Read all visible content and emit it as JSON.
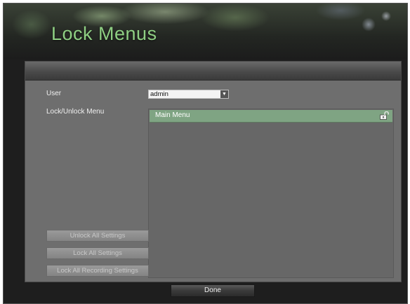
{
  "window": {
    "title": "Lock Menus"
  },
  "form": {
    "user_label": "User",
    "user_value": "admin",
    "lock_menu_label": "Lock/Unlock Menu"
  },
  "menu_list": {
    "items": [
      {
        "label": "Main Menu",
        "icon": "unlocked-padlock-icon",
        "locked": false
      }
    ]
  },
  "actions": {
    "unlock_all": "Unlock All Settings",
    "lock_all": "Lock All Settings",
    "lock_all_recording": "Lock All Recording Settings",
    "done": "Done"
  },
  "colors": {
    "title_green": "#8fcf83",
    "selected_row": "#7fa483",
    "panel": "#6e6e6e",
    "background": "#1e1e1e"
  }
}
